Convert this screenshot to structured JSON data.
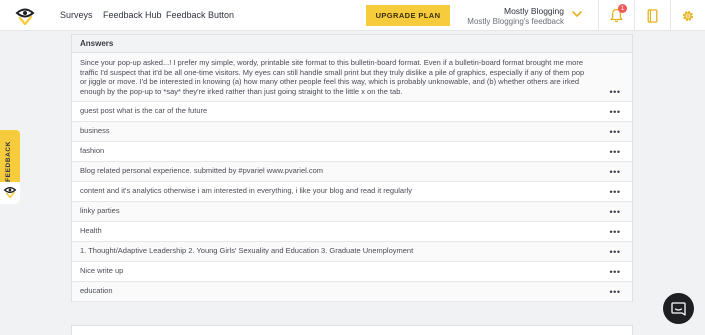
{
  "nav": {
    "items": [
      "Surveys",
      "Feedback Hub",
      "Feedback Button"
    ]
  },
  "toolbar": {
    "upgrade_label": "UPGRADE PLAN",
    "notification_count": "1"
  },
  "account": {
    "name": "Mostly Blogging",
    "feedback": "Mostly Blogging's feedback"
  },
  "feedback_tab": {
    "label": "FEEDBACK"
  },
  "table": {
    "header": "Answers",
    "rows": [
      "Since your pop-up asked...! I prefer my simple, wordy, printable site format to this bulletin-board format. Even if a bulletin-board format brought me more traffic I'd suspect that it'd be all one-time visitors. My eyes can still handle small print but they truly dislike a pile of graphics, especially if any of them pop or jiggle or move. I'd be interested in knowing (a) how many other people feel this way, which is probably unknowable, and (b) whether others are irked enough by the pop-up to *say* they're irked rather than just going straight to the little x on the tab.",
      "guest post what is the car of the future",
      "business",
      "fashion",
      "Blog related personal experience. submitted by #pvariel www.pvariel.com",
      "content and it's analytics otherwise i am interested in everything, i like your blog and read it regularly",
      "linky parties",
      "Health",
      "1. Thought/Adaptive Leadership 2. Young Girls' Sexuality and Education 3. Graduate Unemployment",
      "Nice write up",
      "education"
    ]
  },
  "icons": {
    "logo": "logo-icon",
    "bell": "bell-icon",
    "book": "book-icon",
    "gear": "gear-icon",
    "chevron": "chevron-down-icon",
    "more": "more-options-icon",
    "chat": "chat-icon"
  },
  "colors": {
    "accent": "#f7cc3c",
    "badge": "#ef5a5a",
    "chat_bg": "#1d1f22"
  }
}
